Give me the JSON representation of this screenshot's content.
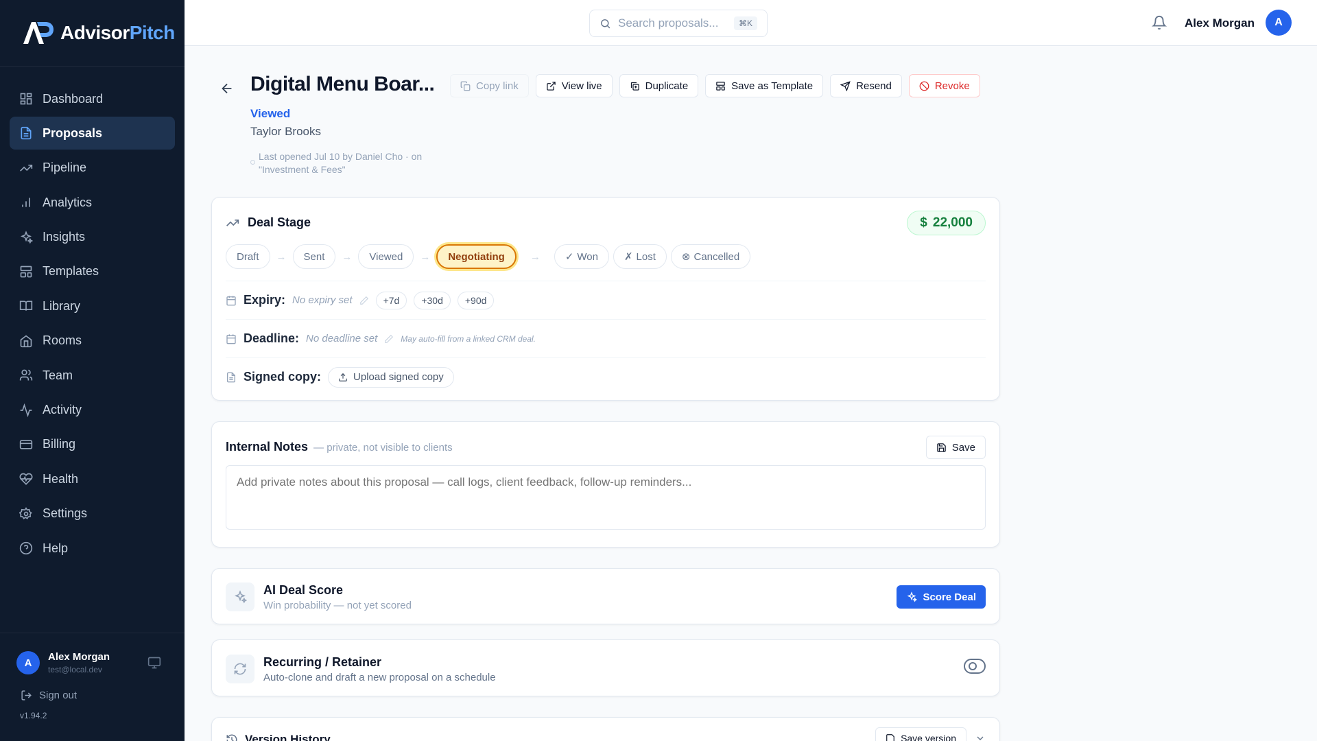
{
  "brand": {
    "name_part1": "Advisor",
    "name_part2": "Pitch"
  },
  "sidebar": {
    "items": [
      {
        "label": "Dashboard",
        "icon": "dashboard-icon"
      },
      {
        "label": "Proposals",
        "icon": "document-icon",
        "active": true
      },
      {
        "label": "Pipeline",
        "icon": "trending-icon"
      },
      {
        "label": "Analytics",
        "icon": "bar-chart-icon"
      },
      {
        "label": "Insights",
        "icon": "sparkles-icon"
      },
      {
        "label": "Templates",
        "icon": "templates-icon"
      },
      {
        "label": "Library",
        "icon": "book-icon"
      },
      {
        "label": "Rooms",
        "icon": "home-icon"
      },
      {
        "label": "Team",
        "icon": "users-icon"
      },
      {
        "label": "Activity",
        "icon": "activity-icon"
      },
      {
        "label": "Billing",
        "icon": "credit-card-icon"
      },
      {
        "label": "Health",
        "icon": "heart-pulse-icon"
      },
      {
        "label": "Settings",
        "icon": "gear-icon"
      },
      {
        "label": "Help",
        "icon": "help-circle-icon"
      }
    ],
    "user": {
      "initial": "A",
      "name": "Alex Morgan",
      "email": "test@local.dev"
    },
    "signout": "Sign out",
    "version": "v1.94.2"
  },
  "topbar": {
    "search_placeholder": "Search proposals...",
    "shortcut": "⌘K",
    "user_name": "Alex Morgan",
    "user_initial": "A"
  },
  "proposal": {
    "title": "Digital Menu Boar...",
    "status": "Viewed",
    "client": "Taylor Brooks",
    "last_opened": "Last opened Jul 10 by Daniel Cho · on \"Investment & Fees\""
  },
  "actions": {
    "copy_link": "Copy link",
    "view_live": "View live",
    "duplicate": "Duplicate",
    "save_template": "Save as Template",
    "resend": "Resend",
    "revoke": "Revoke"
  },
  "deal": {
    "heading": "Deal Stage",
    "amount": "22,000",
    "currency": "$",
    "stages": [
      "Draft",
      "Sent",
      "Viewed",
      "Negotiating"
    ],
    "current_stage": "Negotiating",
    "outcomes": {
      "won": "Won",
      "lost": "Lost",
      "cancelled": "Cancelled"
    },
    "expiry_label": "Expiry:",
    "expiry_value": "No expiry set",
    "expiry_chips": [
      "+7d",
      "+30d",
      "+90d"
    ],
    "deadline_label": "Deadline:",
    "deadline_value": "No deadline set",
    "deadline_hint": "May auto-fill from a linked CRM deal.",
    "signed_label": "Signed copy:",
    "upload_label": "Upload signed copy"
  },
  "notes": {
    "title": "Internal Notes",
    "subtitle": "— private, not visible to clients",
    "save": "Save",
    "placeholder": "Add private notes about this proposal — call logs, client feedback, follow-up reminders..."
  },
  "score": {
    "title": "AI Deal Score",
    "subtitle": "Win probability — not yet scored",
    "button": "Score Deal"
  },
  "recurring": {
    "title": "Recurring / Retainer",
    "subtitle": "Auto-clone and draft a new proposal on a schedule"
  },
  "version_history": {
    "title": "Version History",
    "button": "Save version"
  },
  "colors": {
    "sidebar_bg": "#0f1b2d",
    "accent": "#2563eb",
    "danger": "#dc2626",
    "success": "#15803d",
    "negotiating": "#d97706"
  }
}
